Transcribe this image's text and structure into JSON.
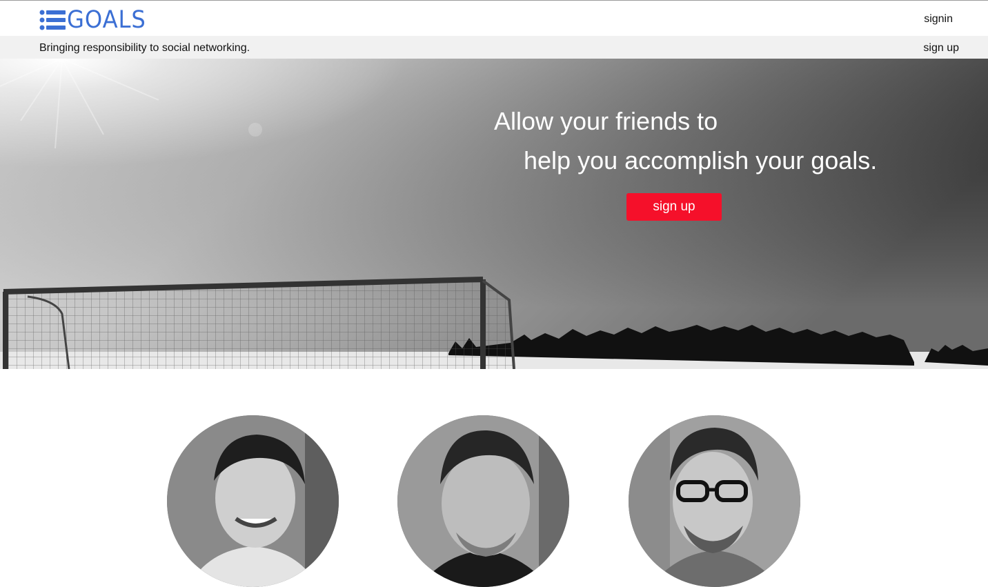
{
  "header": {
    "logo_text": "GOALS",
    "logo_icon": "list-icon",
    "signin_label": "signin",
    "tagline": "Bringing responsibility to social networking.",
    "signup_label": "sign up"
  },
  "hero": {
    "image": "soccer-goal-photo",
    "headline_line1": "Allow your friends to",
    "headline_line2": "help you accomplish your goals.",
    "cta_label": "sign up"
  },
  "team": {
    "avatars": [
      "team-member-1-photo",
      "team-member-2-photo",
      "team-member-3-photo"
    ]
  },
  "colors": {
    "brand_blue": "#3b6fd4",
    "cta_red": "#f5102a",
    "subbar_gray": "#f1f1f1"
  }
}
